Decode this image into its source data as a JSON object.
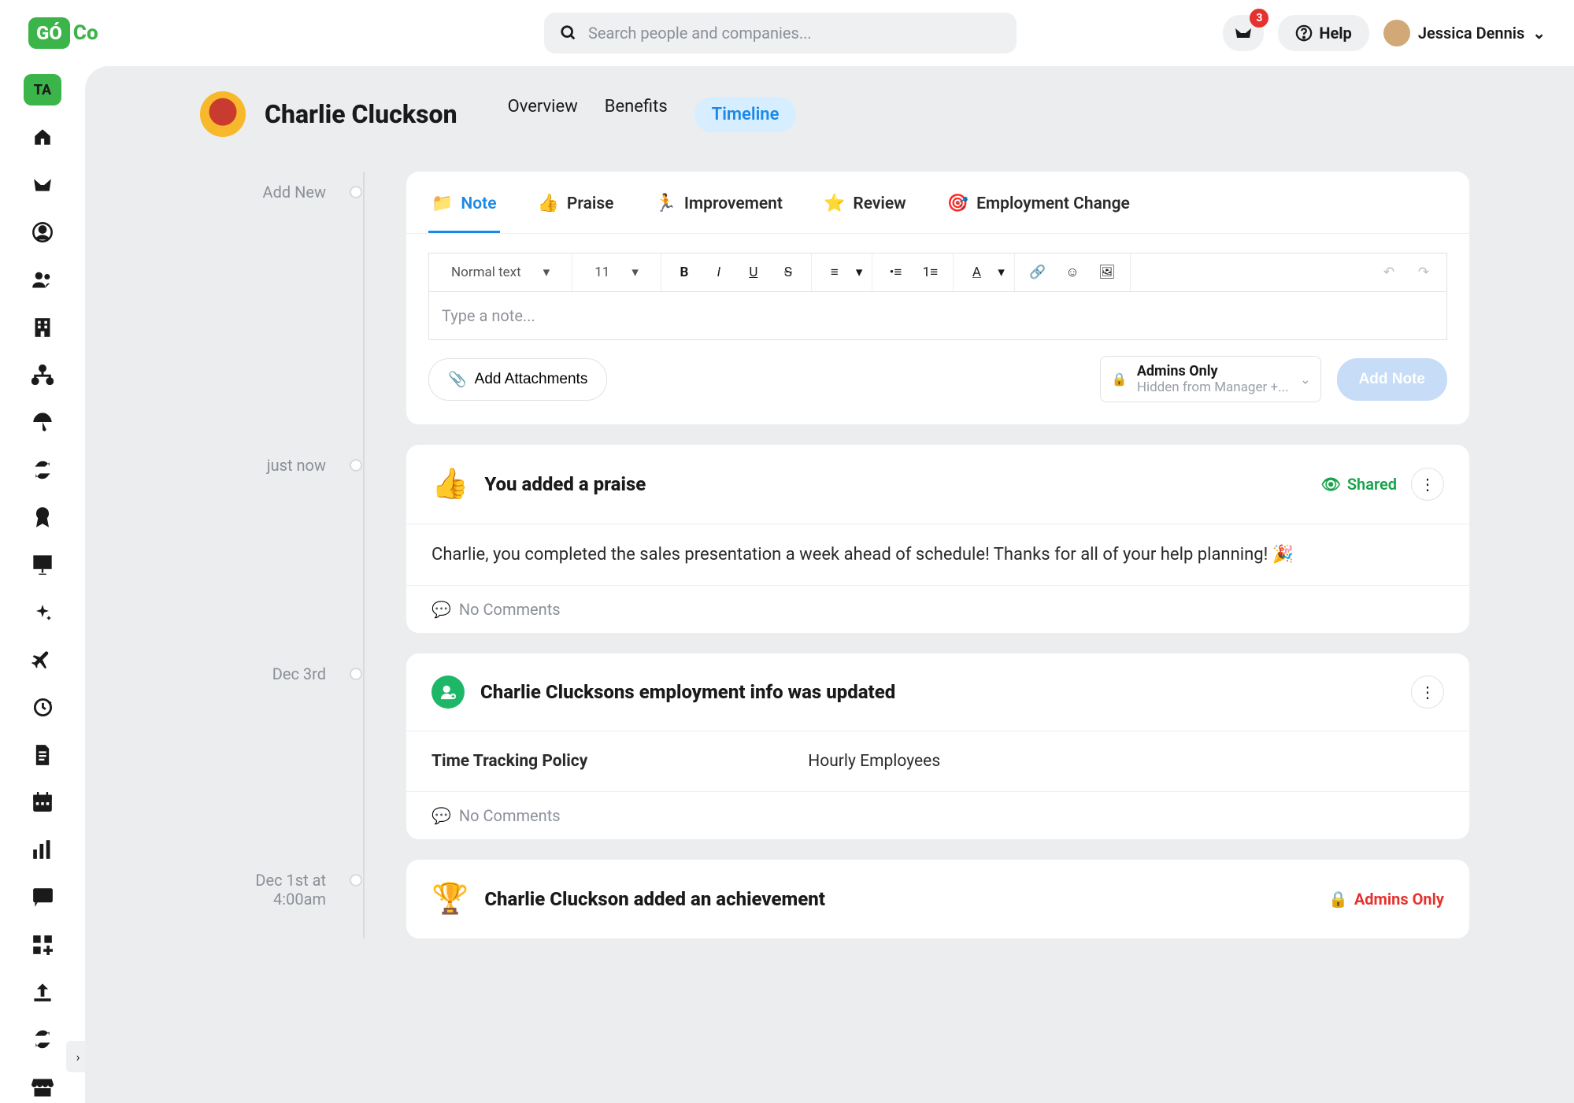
{
  "header": {
    "search_placeholder": "Search people and companies...",
    "notifications_count": "3",
    "help_label": "Help",
    "user_name": "Jessica Dennis"
  },
  "profile": {
    "name": "Charlie Cluckson",
    "tabs": {
      "overview": "Overview",
      "benefits": "Benefits",
      "timeline": "Timeline"
    }
  },
  "sidebar_company": "TA",
  "timeline": {
    "add_new_label": "Add New",
    "composer": {
      "tabs": {
        "note": "Note",
        "praise": "Praise",
        "improvement": "Improvement",
        "review": "Review",
        "employment_change": "Employment Change"
      },
      "text_style": "Normal text",
      "font_size": "11",
      "placeholder": "Type a note...",
      "attach_label": "Add Attachments",
      "privacy_title": "Admins Only",
      "privacy_sub": "Hidden from Manager +...",
      "submit_label": "Add Note"
    },
    "items": [
      {
        "time": "just now",
        "icon": "👍",
        "title": "You added a praise",
        "badge": "Shared",
        "badge_kind": "shared",
        "body": "Charlie, you completed the sales presentation a week ahead of schedule! Thanks for all of your help planning! 🎉",
        "footer": "No Comments"
      },
      {
        "time": "Dec 3rd",
        "icon": "emp-update",
        "title": "Charlie Clucksons employment info was updated",
        "kv_label": "Time Tracking Policy",
        "kv_value": "Hourly Employees",
        "footer": "No Comments"
      },
      {
        "time": "Dec 1st at 4:00am",
        "icon": "🏆",
        "title": "Charlie Cluckson added an achievement",
        "badge": "Admins Only",
        "badge_kind": "admins"
      }
    ]
  }
}
